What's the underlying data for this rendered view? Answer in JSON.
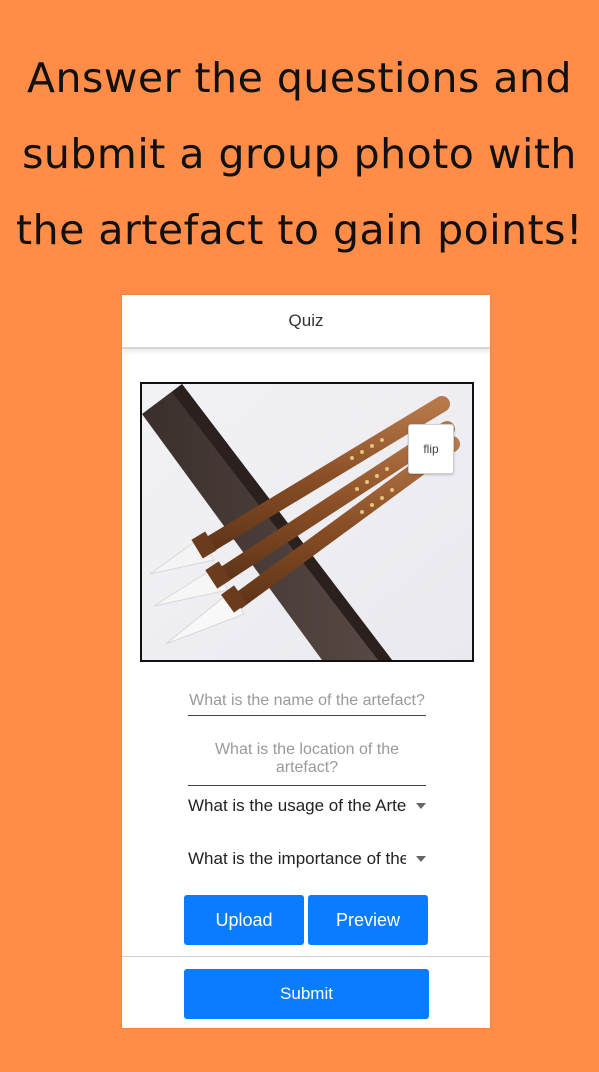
{
  "headline": {
    "line1": "Answer the questions and",
    "line2": "submit a group photo with",
    "line3": "the artefact to gain points!"
  },
  "appbar": {
    "title": "Quiz"
  },
  "photo": {
    "flip_label": "flip"
  },
  "form": {
    "name_placeholder": "What is the name of the artefact?",
    "location_placeholder": "What is the location of the artefact?",
    "usage_select": "What is the usage of the Arte",
    "importance_select": "What is the importance of the"
  },
  "actions": {
    "upload_label": "Upload",
    "preview_label": "Preview",
    "submit_label": "Submit"
  },
  "colors": {
    "background": "#FF8C47",
    "primary_button": "#0A7CFF"
  }
}
